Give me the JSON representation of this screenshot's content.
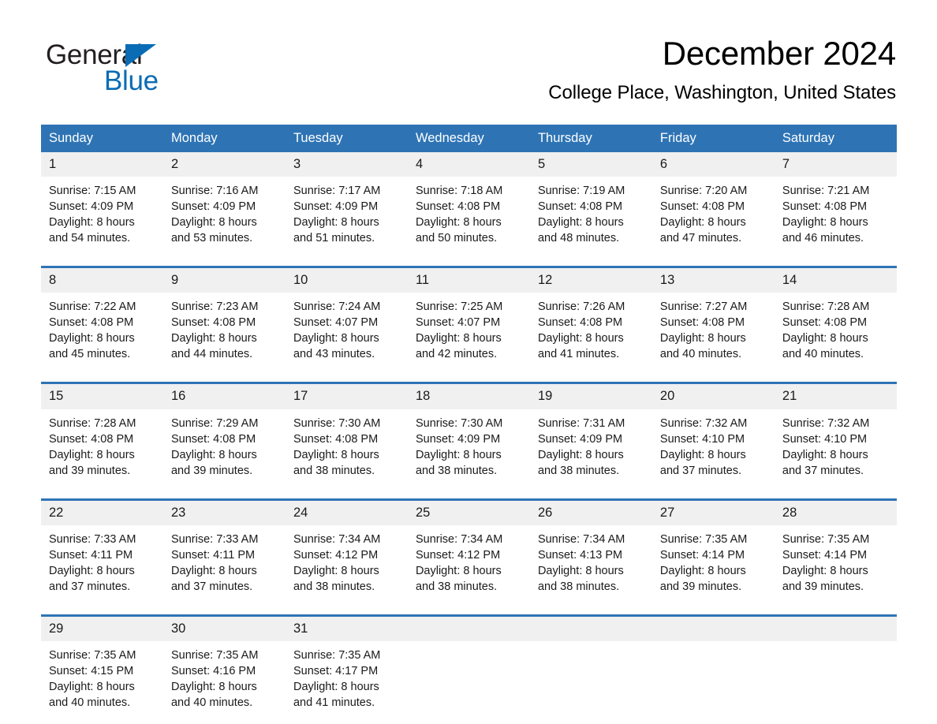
{
  "brand": {
    "name_part1": "General",
    "name_part2": "Blue",
    "accent_color": "#0a6cb4"
  },
  "header": {
    "title": "December 2024",
    "subtitle": "College Place, Washington, United States"
  },
  "theme": {
    "header_blue": "#2e74b5",
    "daynum_gray": "#f0f0f0"
  },
  "weekdays": [
    "Sunday",
    "Monday",
    "Tuesday",
    "Wednesday",
    "Thursday",
    "Friday",
    "Saturday"
  ],
  "weeks": [
    {
      "days": [
        {
          "num": "1",
          "sunrise": "Sunrise: 7:15 AM",
          "sunset": "Sunset: 4:09 PM",
          "daylight1": "Daylight: 8 hours",
          "daylight2": "and 54 minutes."
        },
        {
          "num": "2",
          "sunrise": "Sunrise: 7:16 AM",
          "sunset": "Sunset: 4:09 PM",
          "daylight1": "Daylight: 8 hours",
          "daylight2": "and 53 minutes."
        },
        {
          "num": "3",
          "sunrise": "Sunrise: 7:17 AM",
          "sunset": "Sunset: 4:09 PM",
          "daylight1": "Daylight: 8 hours",
          "daylight2": "and 51 minutes."
        },
        {
          "num": "4",
          "sunrise": "Sunrise: 7:18 AM",
          "sunset": "Sunset: 4:08 PM",
          "daylight1": "Daylight: 8 hours",
          "daylight2": "and 50 minutes."
        },
        {
          "num": "5",
          "sunrise": "Sunrise: 7:19 AM",
          "sunset": "Sunset: 4:08 PM",
          "daylight1": "Daylight: 8 hours",
          "daylight2": "and 48 minutes."
        },
        {
          "num": "6",
          "sunrise": "Sunrise: 7:20 AM",
          "sunset": "Sunset: 4:08 PM",
          "daylight1": "Daylight: 8 hours",
          "daylight2": "and 47 minutes."
        },
        {
          "num": "7",
          "sunrise": "Sunrise: 7:21 AM",
          "sunset": "Sunset: 4:08 PM",
          "daylight1": "Daylight: 8 hours",
          "daylight2": "and 46 minutes."
        }
      ]
    },
    {
      "days": [
        {
          "num": "8",
          "sunrise": "Sunrise: 7:22 AM",
          "sunset": "Sunset: 4:08 PM",
          "daylight1": "Daylight: 8 hours",
          "daylight2": "and 45 minutes."
        },
        {
          "num": "9",
          "sunrise": "Sunrise: 7:23 AM",
          "sunset": "Sunset: 4:08 PM",
          "daylight1": "Daylight: 8 hours",
          "daylight2": "and 44 minutes."
        },
        {
          "num": "10",
          "sunrise": "Sunrise: 7:24 AM",
          "sunset": "Sunset: 4:07 PM",
          "daylight1": "Daylight: 8 hours",
          "daylight2": "and 43 minutes."
        },
        {
          "num": "11",
          "sunrise": "Sunrise: 7:25 AM",
          "sunset": "Sunset: 4:07 PM",
          "daylight1": "Daylight: 8 hours",
          "daylight2": "and 42 minutes."
        },
        {
          "num": "12",
          "sunrise": "Sunrise: 7:26 AM",
          "sunset": "Sunset: 4:08 PM",
          "daylight1": "Daylight: 8 hours",
          "daylight2": "and 41 minutes."
        },
        {
          "num": "13",
          "sunrise": "Sunrise: 7:27 AM",
          "sunset": "Sunset: 4:08 PM",
          "daylight1": "Daylight: 8 hours",
          "daylight2": "and 40 minutes."
        },
        {
          "num": "14",
          "sunrise": "Sunrise: 7:28 AM",
          "sunset": "Sunset: 4:08 PM",
          "daylight1": "Daylight: 8 hours",
          "daylight2": "and 40 minutes."
        }
      ]
    },
    {
      "days": [
        {
          "num": "15",
          "sunrise": "Sunrise: 7:28 AM",
          "sunset": "Sunset: 4:08 PM",
          "daylight1": "Daylight: 8 hours",
          "daylight2": "and 39 minutes."
        },
        {
          "num": "16",
          "sunrise": "Sunrise: 7:29 AM",
          "sunset": "Sunset: 4:08 PM",
          "daylight1": "Daylight: 8 hours",
          "daylight2": "and 39 minutes."
        },
        {
          "num": "17",
          "sunrise": "Sunrise: 7:30 AM",
          "sunset": "Sunset: 4:08 PM",
          "daylight1": "Daylight: 8 hours",
          "daylight2": "and 38 minutes."
        },
        {
          "num": "18",
          "sunrise": "Sunrise: 7:30 AM",
          "sunset": "Sunset: 4:09 PM",
          "daylight1": "Daylight: 8 hours",
          "daylight2": "and 38 minutes."
        },
        {
          "num": "19",
          "sunrise": "Sunrise: 7:31 AM",
          "sunset": "Sunset: 4:09 PM",
          "daylight1": "Daylight: 8 hours",
          "daylight2": "and 38 minutes."
        },
        {
          "num": "20",
          "sunrise": "Sunrise: 7:32 AM",
          "sunset": "Sunset: 4:10 PM",
          "daylight1": "Daylight: 8 hours",
          "daylight2": "and 37 minutes."
        },
        {
          "num": "21",
          "sunrise": "Sunrise: 7:32 AM",
          "sunset": "Sunset: 4:10 PM",
          "daylight1": "Daylight: 8 hours",
          "daylight2": "and 37 minutes."
        }
      ]
    },
    {
      "days": [
        {
          "num": "22",
          "sunrise": "Sunrise: 7:33 AM",
          "sunset": "Sunset: 4:11 PM",
          "daylight1": "Daylight: 8 hours",
          "daylight2": "and 37 minutes."
        },
        {
          "num": "23",
          "sunrise": "Sunrise: 7:33 AM",
          "sunset": "Sunset: 4:11 PM",
          "daylight1": "Daylight: 8 hours",
          "daylight2": "and 37 minutes."
        },
        {
          "num": "24",
          "sunrise": "Sunrise: 7:34 AM",
          "sunset": "Sunset: 4:12 PM",
          "daylight1": "Daylight: 8 hours",
          "daylight2": "and 38 minutes."
        },
        {
          "num": "25",
          "sunrise": "Sunrise: 7:34 AM",
          "sunset": "Sunset: 4:12 PM",
          "daylight1": "Daylight: 8 hours",
          "daylight2": "and 38 minutes."
        },
        {
          "num": "26",
          "sunrise": "Sunrise: 7:34 AM",
          "sunset": "Sunset: 4:13 PM",
          "daylight1": "Daylight: 8 hours",
          "daylight2": "and 38 minutes."
        },
        {
          "num": "27",
          "sunrise": "Sunrise: 7:35 AM",
          "sunset": "Sunset: 4:14 PM",
          "daylight1": "Daylight: 8 hours",
          "daylight2": "and 39 minutes."
        },
        {
          "num": "28",
          "sunrise": "Sunrise: 7:35 AM",
          "sunset": "Sunset: 4:14 PM",
          "daylight1": "Daylight: 8 hours",
          "daylight2": "and 39 minutes."
        }
      ]
    },
    {
      "days": [
        {
          "num": "29",
          "sunrise": "Sunrise: 7:35 AM",
          "sunset": "Sunset: 4:15 PM",
          "daylight1": "Daylight: 8 hours",
          "daylight2": "and 40 minutes."
        },
        {
          "num": "30",
          "sunrise": "Sunrise: 7:35 AM",
          "sunset": "Sunset: 4:16 PM",
          "daylight1": "Daylight: 8 hours",
          "daylight2": "and 40 minutes."
        },
        {
          "num": "31",
          "sunrise": "Sunrise: 7:35 AM",
          "sunset": "Sunset: 4:17 PM",
          "daylight1": "Daylight: 8 hours",
          "daylight2": "and 41 minutes."
        },
        {
          "num": "",
          "sunrise": "",
          "sunset": "",
          "daylight1": "",
          "daylight2": ""
        },
        {
          "num": "",
          "sunrise": "",
          "sunset": "",
          "daylight1": "",
          "daylight2": ""
        },
        {
          "num": "",
          "sunrise": "",
          "sunset": "",
          "daylight1": "",
          "daylight2": ""
        },
        {
          "num": "",
          "sunrise": "",
          "sunset": "",
          "daylight1": "",
          "daylight2": ""
        }
      ]
    }
  ]
}
